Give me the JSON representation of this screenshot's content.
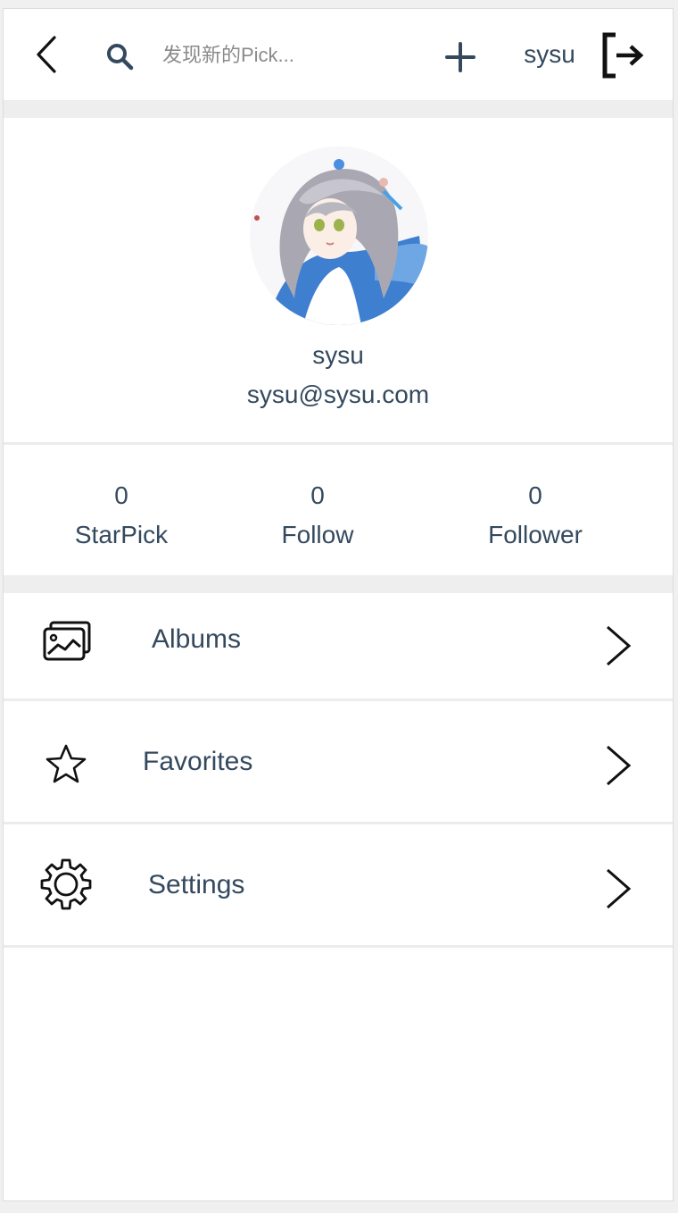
{
  "header": {
    "search_placeholder": "发现新的Pick...",
    "username": "sysu"
  },
  "profile": {
    "name": "sysu",
    "email": "sysu@sysu.com"
  },
  "stats": [
    {
      "value": "0",
      "label": "StarPick"
    },
    {
      "value": "0",
      "label": "Follow"
    },
    {
      "value": "0",
      "label": "Follower"
    }
  ],
  "menu": [
    {
      "label": "Albums",
      "icon": "albums-icon"
    },
    {
      "label": "Favorites",
      "icon": "star-icon"
    },
    {
      "label": "Settings",
      "icon": "gear-icon"
    }
  ],
  "colors": {
    "text": "#34495e",
    "band": "#eeeeee",
    "avatar_blue": "#3f7fd0"
  }
}
